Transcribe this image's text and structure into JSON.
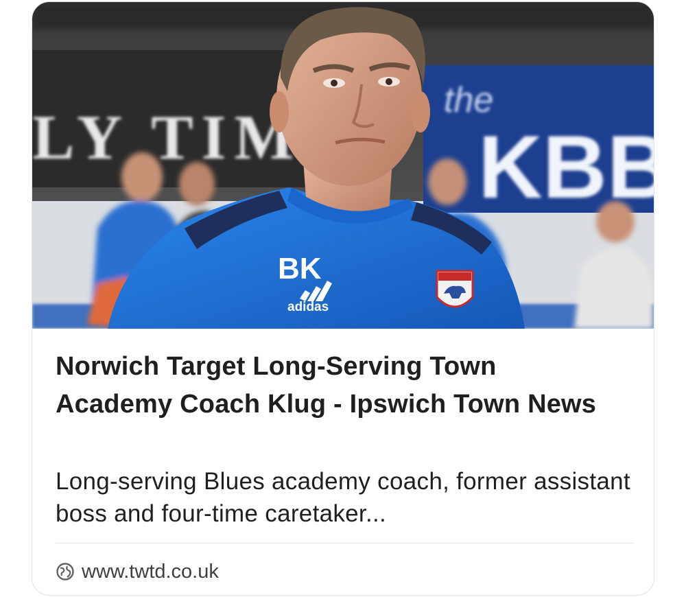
{
  "article": {
    "image_alt": "Man in blue training top with BK initials standing in a stadium",
    "title": "Norwich Target Long-Serving Town Academy Coach Klug - Ipswich Town News",
    "snippet": "Long-serving Blues academy coach, former assistant boss and four-time caretaker...",
    "source_domain": "www.twtd.co.uk"
  },
  "photo_text": {
    "banner_left": "LY TIM",
    "banner_right_small": "the",
    "banner_right_large": "KBB",
    "shirt_initials": "BK",
    "shirt_brand": "adidas"
  },
  "colors": {
    "shirt_blue": "#1e73d8",
    "banner_blue": "#1d3f8f",
    "title_text": "#1f1f1f",
    "source_text": "#3c4043"
  },
  "icons": {
    "source": "globe-icon"
  }
}
